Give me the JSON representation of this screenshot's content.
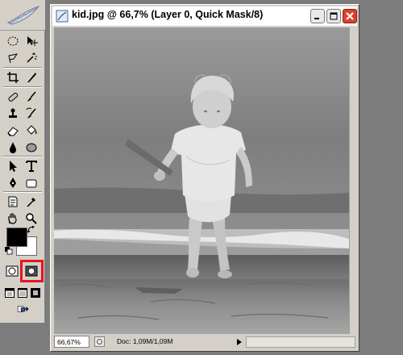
{
  "document": {
    "title": "kid.jpg @ 66,7% (Layer 0, Quick Mask/8)",
    "zoom": "66,67%",
    "doc_info": "Doc: 1,09M/1,09M"
  },
  "tools": [
    "marquee-tool",
    "move-tool",
    "lasso-tool",
    "magic-wand-tool",
    "crop-tool",
    "slice-tool",
    "healing-brush-tool",
    "brush-tool",
    "clone-stamp-tool",
    "history-brush-tool",
    "eraser-tool",
    "paint-bucket-tool",
    "blur-tool",
    "dodge-tool",
    "path-selection-tool",
    "type-tool",
    "pen-tool",
    "shape-tool",
    "notes-tool",
    "eyedropper-tool",
    "hand-tool",
    "zoom-tool"
  ],
  "colors": {
    "foreground": "#000000",
    "background": "#ffffff",
    "highlight": "#e8131f",
    "close_button": "#d9422c"
  },
  "quick_mask": {
    "active_mode": "quick-mask-mode",
    "highlighted": true
  }
}
